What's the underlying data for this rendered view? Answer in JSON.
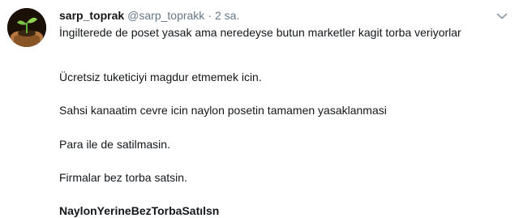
{
  "tweet": {
    "fullname": "sarp_toprak",
    "handle": "@sarp_toprakk",
    "separator": "·",
    "time": "2 sa.",
    "lines": [
      "İngilterede de poset yasak ama neredeyse butun marketler kagit torba veriyorlar",
      "Ücretsiz tuketiciyi magdur etmemek icin.",
      "Sahsi kanaatim cevre icin naylon posetin tamamen yasaklanmasi",
      "Para ile de satilmasin.",
      "Firmalar bez torba satsin.",
      "NaylonYerineBezTorbaSatılsn"
    ],
    "icons": {
      "avatar": "seedling-in-hands-avatar",
      "menu": "chevron-down-icon"
    }
  }
}
